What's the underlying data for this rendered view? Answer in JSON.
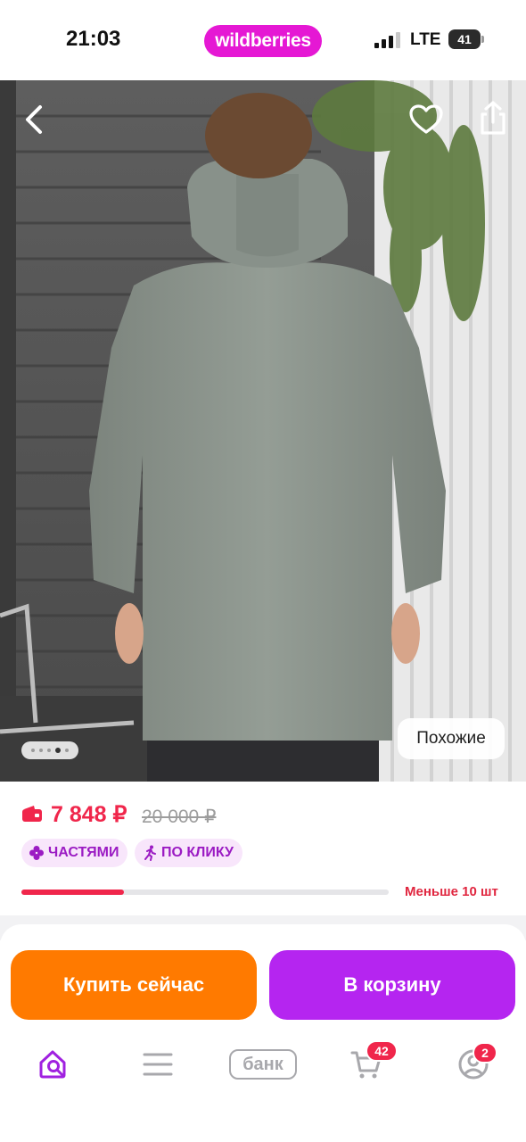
{
  "status_bar": {
    "time": "21:03",
    "brand": "wildberries",
    "network": "LTE",
    "battery": "41"
  },
  "gallery": {
    "current_slide": 4,
    "slide_count": 5,
    "similar_label": "Похожие",
    "icons": [
      "back-arrow-icon",
      "heart-icon",
      "share-icon"
    ]
  },
  "product": {
    "price": "7 848 ₽",
    "old_price": "20 000 ₽",
    "installment_label": "ЧАСТЯМИ",
    "one_click_label": "ПО КЛИКУ",
    "stock_label": "Меньше 10 шт",
    "stock_level_percent": 28
  },
  "actions": {
    "buy_now": "Купить сейчас",
    "add_to_cart": "В корзину"
  },
  "tabbar": {
    "bank_label": "банк",
    "cart_badge": "42",
    "profile_badge": "2"
  },
  "colors": {
    "brand": "#e518d4",
    "price": "#f0264b",
    "buy_now": "#ff7a00",
    "add_to_cart": "#b525f0",
    "active_tab": "#a021e0"
  }
}
